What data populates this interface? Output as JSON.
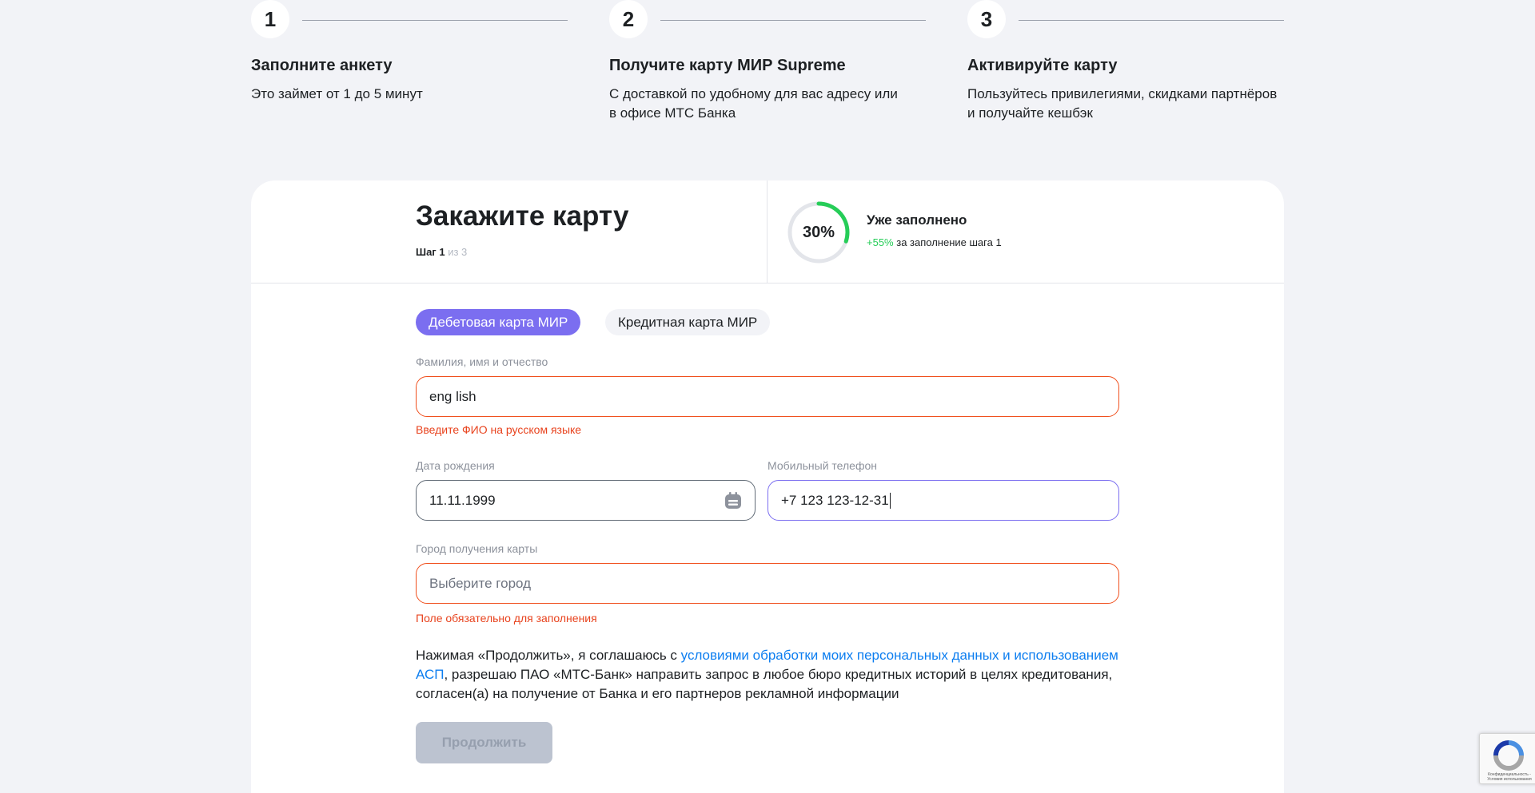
{
  "steps": [
    {
      "number": "1",
      "title": "Заполните анкету",
      "desc_line1": "Это займет от 1 до 5 минут",
      "desc_line2": ""
    },
    {
      "number": "2",
      "title": "Получите карту МИР Supreme",
      "desc_line1": "С доставкой по удобному для вас адресу или",
      "desc_line2": "в офисе МТС Банка"
    },
    {
      "number": "3",
      "title": "Активируйте карту",
      "desc_line1": "Пользуйтесь привилегиями, скидками партнёров",
      "desc_line2": "и получайте кешбэк"
    }
  ],
  "form": {
    "title": "Закажите карту",
    "step_current": "Шаг 1",
    "step_total": "из 3"
  },
  "progress": {
    "percent_label": "30%",
    "value": 0.3,
    "title": "Уже заполнено",
    "bonus": "+55%",
    "bonus_text": "за заполнение шага 1",
    "color": "#26cd58"
  },
  "card_types": {
    "debit": "Дебетовая карта МИР",
    "credit": "Кредитная карта МИР",
    "active_color": "#7b6ef0"
  },
  "fields": {
    "fio": {
      "label": "Фамилия, имя и отчество",
      "value": "eng lish",
      "error": "Введите ФИО на русском языке"
    },
    "birthdate": {
      "label": "Дата рождения",
      "value": "11.11.1999",
      "icon": "calendar-icon"
    },
    "phone": {
      "label": "Мобильный телефон",
      "value": "+7 123 123-12-31"
    },
    "city": {
      "label": "Город получения карты",
      "placeholder": "Выберите город",
      "error": "Поле обязательно для заполнения"
    }
  },
  "consent": {
    "before": "Нажимая «Продолжить», я соглашаюсь с ",
    "link": "условиями обработки моих персональных данных и использованием АСП",
    "after": ", разрешаю ПАО «МТС-Банк» направить запрос в любое бюро кредитных историй в целях кредитования, согласен(а) на получение от Банка и его партнеров рекламной информации"
  },
  "buttons": {
    "continue": "Продолжить"
  },
  "recaptcha": {
    "text": "Конфиденциальность - Условия использования"
  }
}
